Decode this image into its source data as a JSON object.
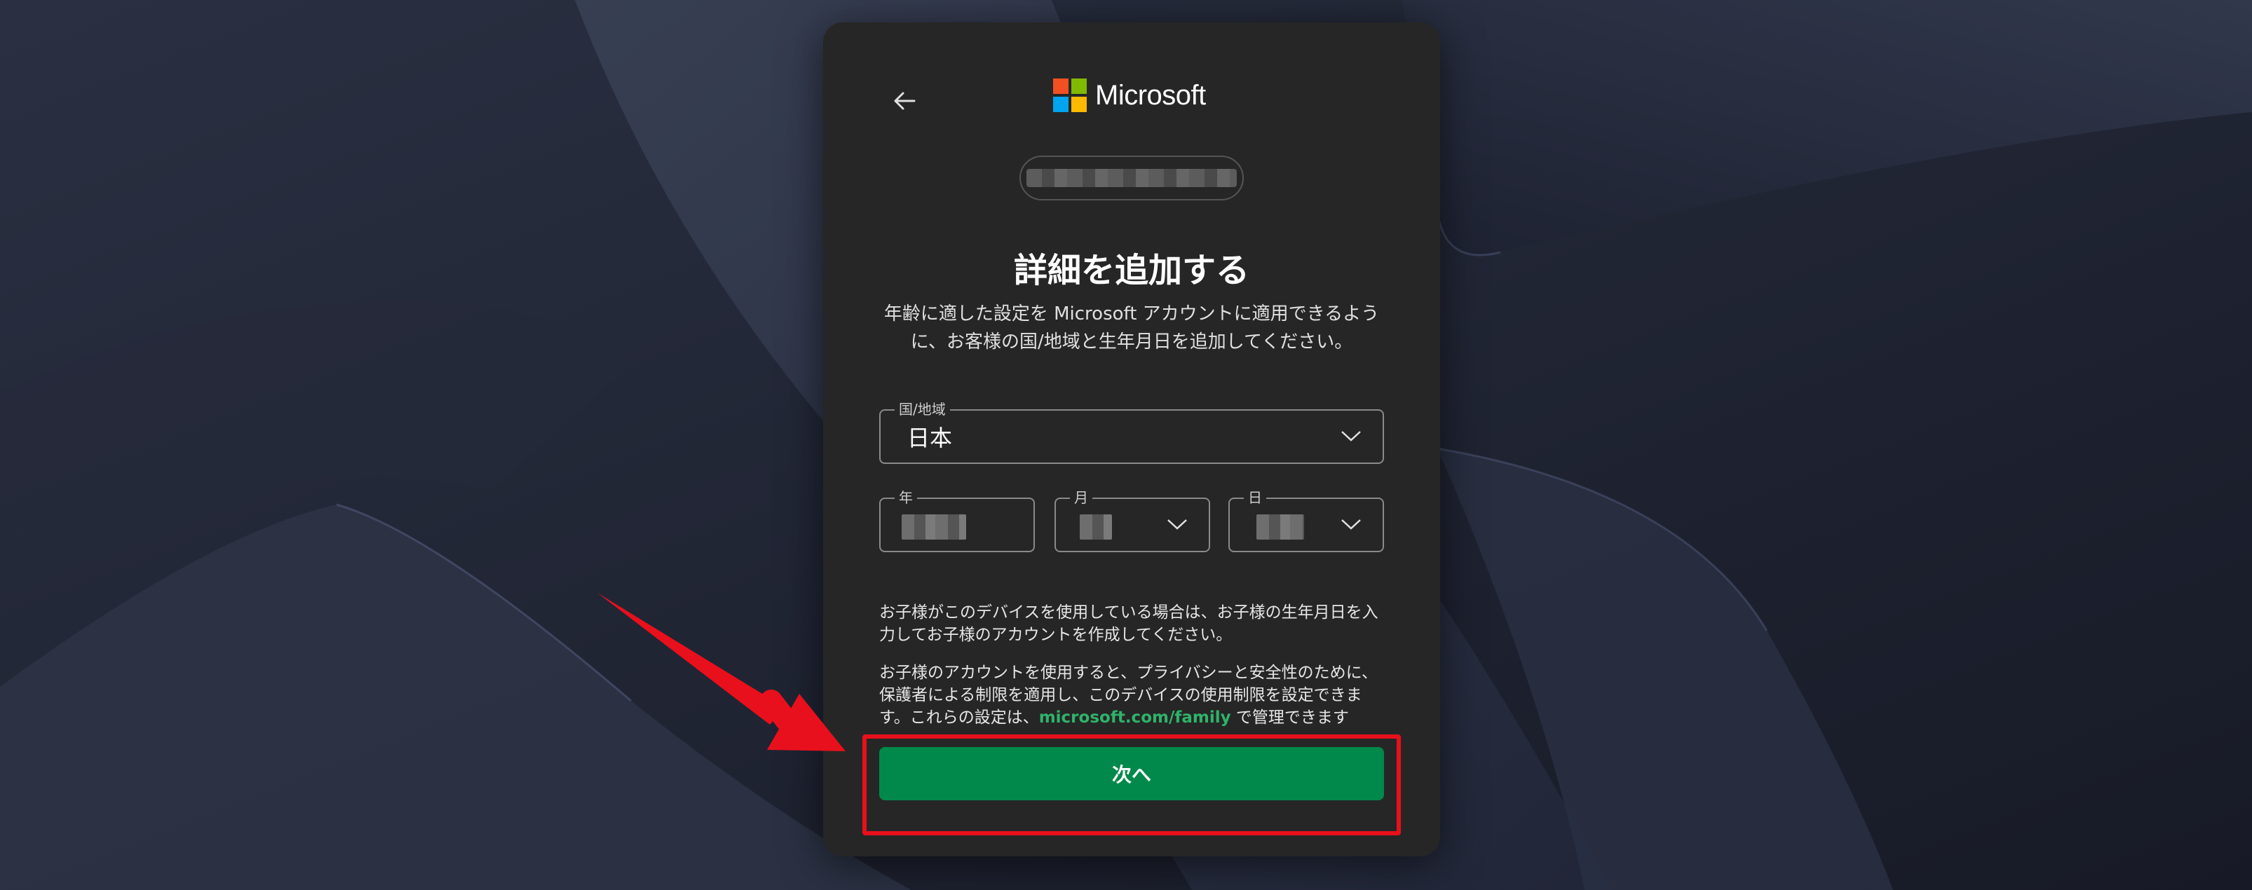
{
  "brand": {
    "name": "Microsoft",
    "logo_colors": [
      "#f25022",
      "#7fba00",
      "#00a4ef",
      "#ffb900"
    ]
  },
  "header": {
    "back_icon": "arrow-left-icon"
  },
  "heading": "詳細を追加する",
  "description": "年齢に適した設定を Microsoft アカウントに適用できるように、お客様の国/地域と生年月日を追加してください。",
  "form": {
    "country": {
      "label": "国/地域",
      "value": "日本"
    },
    "year": {
      "label": "年"
    },
    "month": {
      "label": "月"
    },
    "day": {
      "label": "日"
    }
  },
  "info": {
    "paragraph1": "お子様がこのデバイスを使用している場合は、お子様の生年月日を入力してお子様のアカウントを作成してください。",
    "paragraph2_before": "お子様のアカウントを使用すると、プライバシーと安全性のために、保護者による制限を適用し、このデバイスの使用制限を設定できます。これらの設定は、",
    "paragraph2_link": "microsoft.com/family",
    "paragraph2_after": " で管理できます"
  },
  "actions": {
    "next_label": "次へ"
  },
  "colors": {
    "accent": "#00894a",
    "link": "#2fb36a",
    "annotation": "#e8101c"
  }
}
